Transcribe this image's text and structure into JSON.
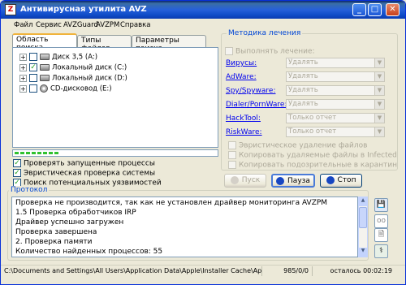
{
  "window": {
    "title": "Антивирусная утилита AVZ",
    "app_icon_glyph": "Z"
  },
  "titlebar_buttons": {
    "minimize": "_",
    "maximize": "□",
    "close": "✕"
  },
  "menu": [
    "Файл",
    "Сервис",
    "AVZGuard",
    "AVZPM",
    "Справка"
  ],
  "tabs": [
    "Область поиска",
    "Типы файлов",
    "Параметры поиска"
  ],
  "drives": [
    {
      "label": "Диск 3,5 (A:)",
      "checked": false,
      "expander": "+"
    },
    {
      "label": "Локальный диск (C:)",
      "checked": true,
      "expander": "+"
    },
    {
      "label": "Локальный диск (D:)",
      "checked": false,
      "expander": "+"
    },
    {
      "label": "CD-дисковод (E:)",
      "checked": false,
      "expander": "+"
    }
  ],
  "progress": {
    "value_fraction": 0.22
  },
  "search_options": [
    {
      "label": "Проверять запущенные процессы",
      "checked": true
    },
    {
      "label": "Эвристическая проверка системы",
      "checked": true
    },
    {
      "label": "Поиск потенциальных уязвимостей",
      "checked": true
    }
  ],
  "method": {
    "title": "Методика лечения",
    "perform_label": "Выполнять лечение:",
    "rows": [
      {
        "label": "Вирусы:",
        "value": "Удалять"
      },
      {
        "label": "AdWare:",
        "value": "Удалять"
      },
      {
        "label": "Spy/Spyware:",
        "value": "Удалять"
      },
      {
        "label": "Dialer/PornWare:",
        "value": "Удалять"
      },
      {
        "label": "HackTool:",
        "value": "Только отчет"
      },
      {
        "label": "RiskWare:",
        "value": "Только отчет"
      }
    ],
    "extra": [
      "Эвристическое удаление файлов",
      "Копировать удаляемые файлы в Infected",
      "Копировать подозрительные в карантин"
    ]
  },
  "buttons": {
    "start": "Пуск",
    "pause": "Пауза",
    "stop": "Стоп"
  },
  "protocol": {
    "title": "Протокол",
    "lines": [
      "Проверка не производится, так как не установлен драйвер мониторинга AVZPM",
      "1.5 Проверка обработчиков IRP",
      "Драйвер успешно загружен",
      "Проверка завершена",
      "2. Проверка памяти",
      "Количество найденных процессов: 55"
    ]
  },
  "side_icons": [
    "save-icon",
    "glasses-icon",
    "document-icon",
    "antivirus-icon"
  ],
  "status": {
    "path": "C:\\Documents and Settings\\All Users\\Application Data\\Apple\\Installer Cache\\Apple Software U",
    "count": "985/0/0",
    "remaining": "осталось 00:02:19"
  },
  "colors": {
    "group_title": "#0046d5",
    "link": "#0000ee",
    "titlebar": "#2660d9",
    "check": "#21a121"
  }
}
